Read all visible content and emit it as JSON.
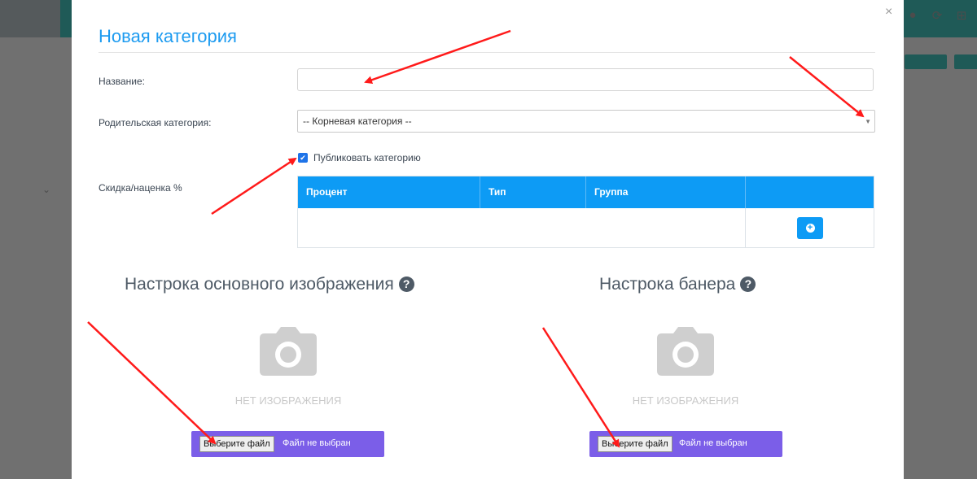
{
  "modal": {
    "title": "Новая категория",
    "close_icon": "×",
    "name_label": "Название:",
    "name_value": "",
    "parent_label": "Родительская категория:",
    "parent_value": "-- Корневая категория --",
    "publish_label": "Публиковать категорию",
    "publish_checked": true,
    "discount_label": "Скидка/наценка %",
    "table": {
      "columns": [
        "Процент",
        "Тип",
        "Группа",
        ""
      ]
    },
    "main_image": {
      "title": "Настрока основного изображения",
      "placeholder": "НЕТ ИЗОБРАЖЕНИЯ",
      "file_button": "Выберите файл",
      "file_status": "Файл не выбран"
    },
    "banner": {
      "title": "Настрока банера",
      "placeholder": "НЕТ ИЗОБРАЖЕНИЯ",
      "file_button": "Выберите файл",
      "file_status": "Файл не выбран"
    }
  },
  "colors": {
    "accent": "#0d9bf5",
    "file_box": "#7b5ee8",
    "annotation_arrow": "#ff1a1a"
  }
}
